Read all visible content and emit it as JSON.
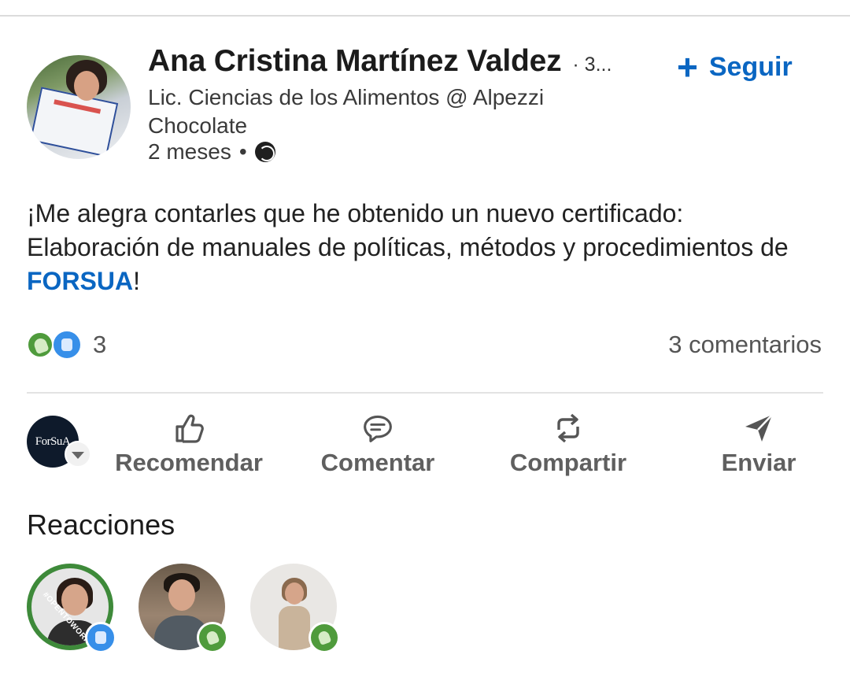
{
  "author": {
    "name": "Ana Cristina Martínez Valdez",
    "degree": "· 3...",
    "headline": "Lic. Ciencias de los Alimentos @ Alpezzi Chocolate",
    "time": "2 meses",
    "separator": "•",
    "visibility_icon": "globe-icon"
  },
  "follow": {
    "icon": "plus-icon",
    "plus": "+",
    "label": "Seguir"
  },
  "post": {
    "text_before": "¡Me alegra contarles que he obtenido un nuevo certificado: Elaboración de manuales de políticas, métodos y procedimientos de ",
    "mention": "FORSUA",
    "text_after": "!"
  },
  "social": {
    "reaction_icons": [
      "clap-icon",
      "like-icon"
    ],
    "reaction_count": "3",
    "comments": "3 comentarios"
  },
  "actor": {
    "logo_text": "ForSuA",
    "dropdown_icon": "chevron-down-icon"
  },
  "actions": {
    "like": "Recomendar",
    "comment": "Comentar",
    "share": "Compartir",
    "send": "Enviar"
  },
  "reactions": {
    "heading": "Reacciones",
    "people": [
      {
        "frame_text": "#OPENTOWORK",
        "badge": "like-icon"
      },
      {
        "badge": "clap-icon"
      },
      {
        "badge": "clap-icon"
      }
    ]
  },
  "colors": {
    "accent": "#0a66c2",
    "like": "#378fe9",
    "celebrate": "#4f9b3c",
    "action_text": "#5f5f5f"
  }
}
